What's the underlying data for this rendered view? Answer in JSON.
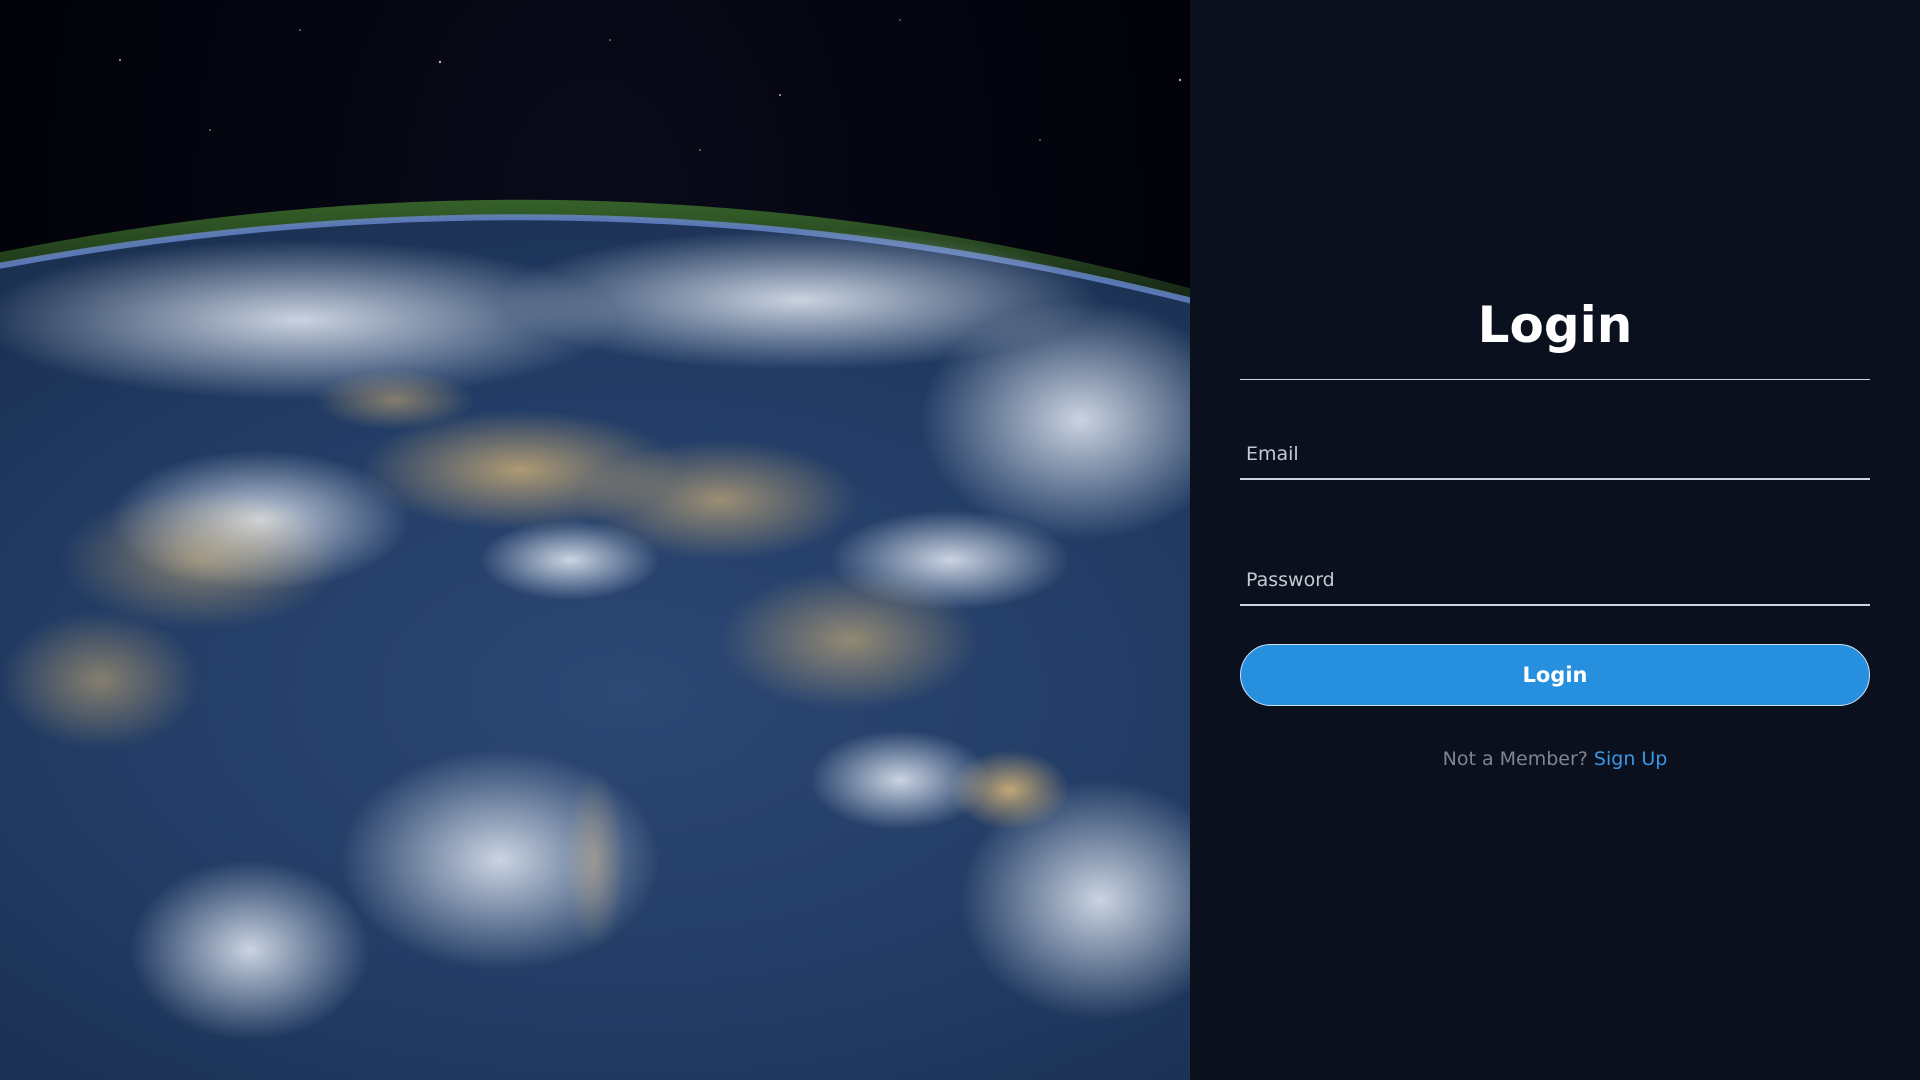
{
  "hero": {
    "image_description_icon": "earth-from-space-icon"
  },
  "form": {
    "title": "Login",
    "email": {
      "placeholder": "Email",
      "value": ""
    },
    "password": {
      "placeholder": "Password",
      "value": ""
    },
    "submit_label": "Login",
    "signup_prompt": "Not a Member?",
    "signup_link": "Sign Up"
  },
  "colors": {
    "background": "#0b101e",
    "accent": "#2690de",
    "link": "#3a96e6",
    "muted_text": "#7e8591"
  }
}
